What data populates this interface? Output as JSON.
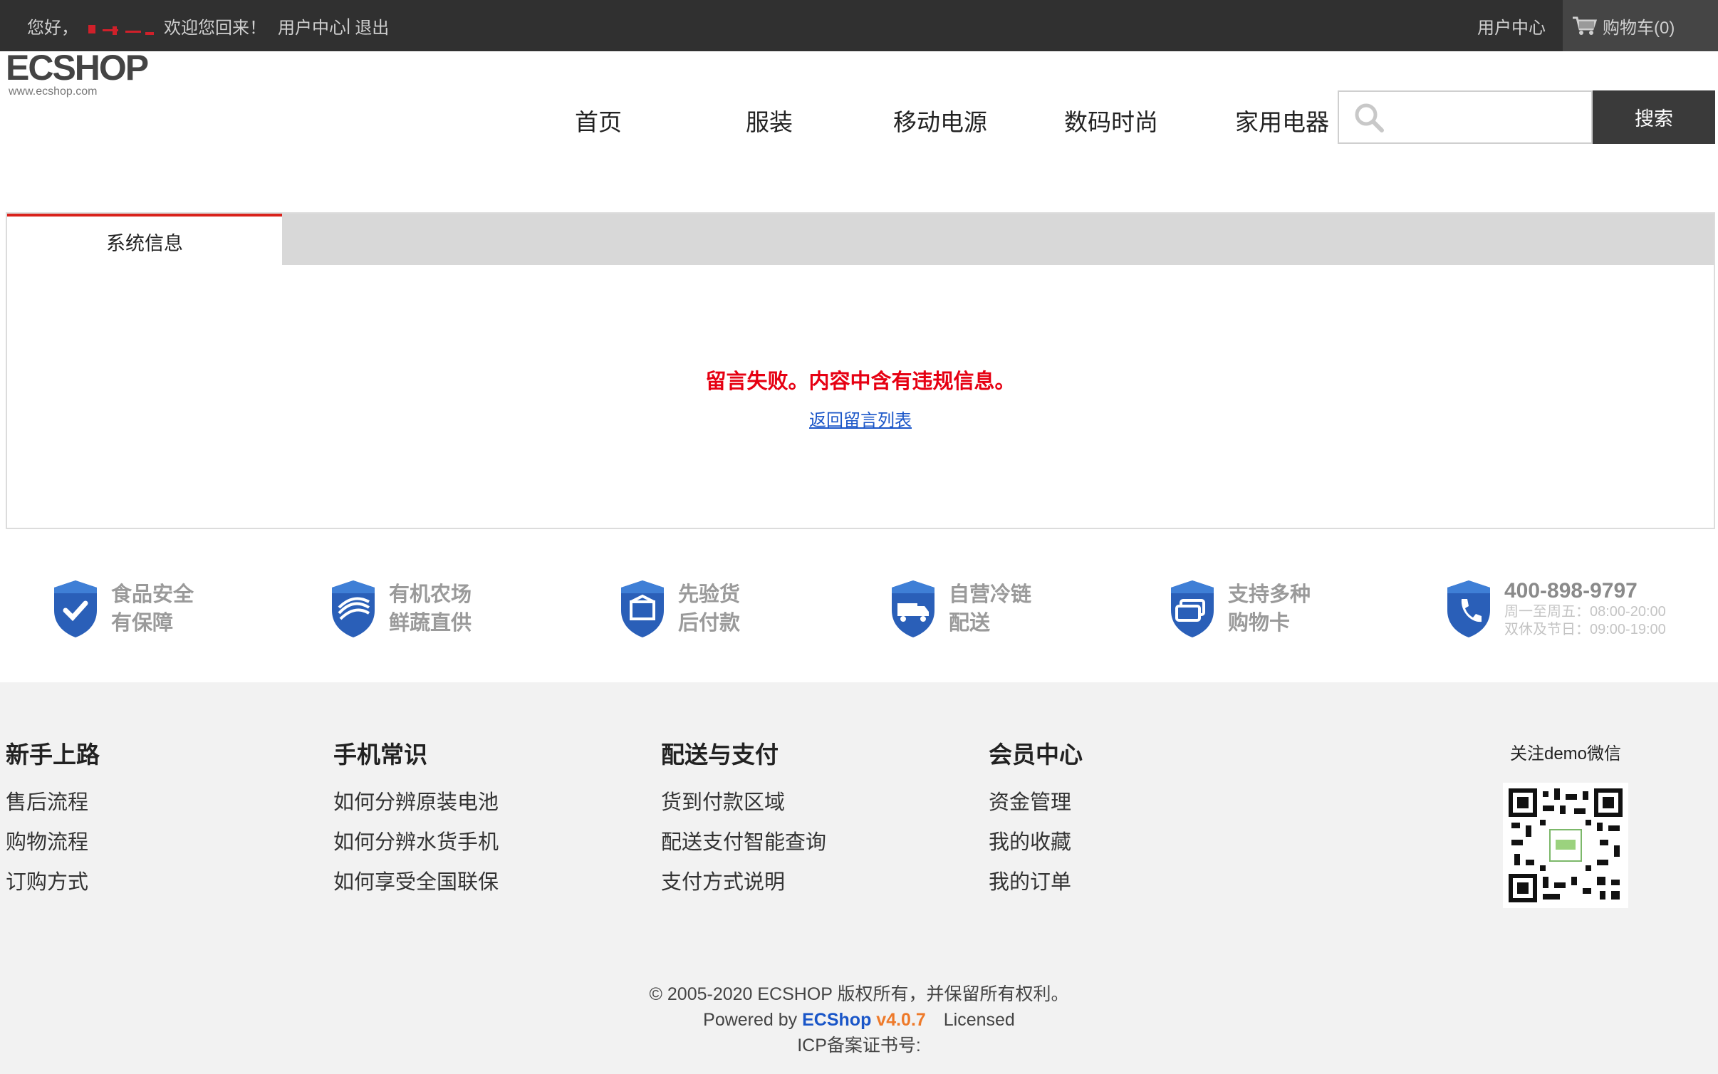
{
  "topbar": {
    "greeting": "您好，",
    "welcome": "欢迎您回来！",
    "user_center_link": "用户中心",
    "separator": "|",
    "logout_link": "退出",
    "right_user_center": "用户中心",
    "cart_label": "购物车(0)"
  },
  "logo": {
    "text": "ECSHOP",
    "url_text": "www.ecshop.com"
  },
  "nav": {
    "items": [
      "首页",
      "服装",
      "移动电源",
      "数码时尚",
      "家用电器"
    ]
  },
  "search": {
    "placeholder": "",
    "button_label": "搜索"
  },
  "panel": {
    "tab_label": "系统信息",
    "message": "留言失败。内容中含有违规信息。",
    "back_link": "返回留言列表"
  },
  "features": [
    {
      "line1": "食品安全",
      "line2": "有保障",
      "icon": "check-shield-icon"
    },
    {
      "line1": "有机农场",
      "line2": "鲜蔬直供",
      "icon": "farm-shield-icon"
    },
    {
      "line1": "先验货",
      "line2": "后付款",
      "icon": "box-shield-icon"
    },
    {
      "line1": "自营冷链",
      "line2": "配送",
      "icon": "truck-shield-icon"
    },
    {
      "line1": "支持多种",
      "line2": "购物卡",
      "icon": "card-shield-icon"
    }
  ],
  "hotline": {
    "phone": "400-898-9797",
    "hours1": "周一至周五：08:00-20:00",
    "hours2": "双休及节日：09:00-19:00",
    "icon": "phone-shield-icon"
  },
  "footer": {
    "columns": [
      {
        "title": "新手上路",
        "links": [
          "售后流程",
          "购物流程",
          "订购方式"
        ]
      },
      {
        "title": "手机常识",
        "links": [
          "如何分辨原装电池",
          "如何分辨水货手机",
          "如何享受全国联保"
        ]
      },
      {
        "title": "配送与支付",
        "links": [
          "货到付款区域",
          "配送支付智能查询",
          "支付方式说明"
        ]
      },
      {
        "title": "会员中心",
        "links": [
          "资金管理",
          "我的收藏",
          "我的订单"
        ]
      }
    ],
    "wechat_label": "关注demo微信",
    "copyright": "© 2005-2020 ECSHOP 版权所有，并保留所有权利。",
    "powered_by": "Powered by",
    "brand": "ECShop",
    "version": "v4.0.7",
    "licensed": "Licensed",
    "icp": "ICP备案证书号:"
  },
  "colors": {
    "topbar_bg": "#303030",
    "accent_red": "#d9221c",
    "error_text": "#e60012",
    "link_blue": "#1a56c8",
    "shield_blue": "#2a5fb8",
    "version_orange": "#ee7a2a"
  }
}
